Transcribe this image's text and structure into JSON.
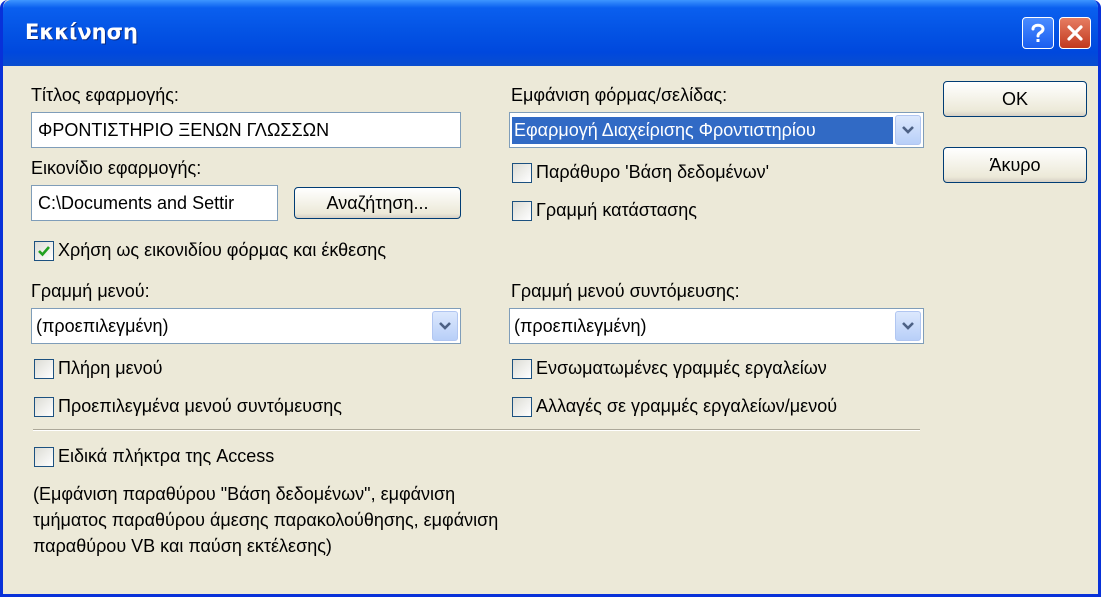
{
  "window": {
    "title": "Εκκίνηση"
  },
  "titlebar": {
    "help_icon": "question-mark-icon",
    "close_icon": "close-x-icon"
  },
  "form": {
    "app_title_label": "Τίτλος εφαρμογής:",
    "app_title_value": "ΦΡΟΝΤΙΣΤΗΡΙΟ ΞΕΝΩΝ ΓΛΩΣΣΩΝ",
    "app_icon_label": "Εικονίδιο εφαρμογής:",
    "app_icon_value": "C:\\Documents and Settir",
    "browse_label": "Αναζήτηση...",
    "use_as_icon_label": "Χρήση ως εικονιδίου φόρμας και έκθεσης",
    "use_as_icon_checked": true,
    "menu_bar_label": "Γραμμή μενού:",
    "menu_bar_value": "(προεπιλεγμένη)",
    "full_menus_label": "Πλήρη μενού",
    "default_shortcut_menus_label": "Προεπιλεγμένα μενού συντόμευσης",
    "display_form_label": "Εμφάνιση φόρμας/σελίδας:",
    "display_form_value": "Εφαρμογή Διαχείρισης Φροντιστηρίου",
    "database_window_label": "Παράθυρο 'Βάση δεδομένων'",
    "status_bar_label": "Γραμμή κατάστασης",
    "shortcut_menu_bar_label": "Γραμμή μενού συντόμευσης:",
    "shortcut_menu_bar_value": "(προεπιλεγμένη)",
    "builtin_toolbars_label": "Ενσωματωμένες γραμμές εργαλείων",
    "toolbar_changes_label": "Αλλαγές σε γραμμές εργαλείων/μενού",
    "special_keys_label": "Ειδικά πλήκτρα της Access",
    "special_keys_note": "(Εμφάνιση παραθύρου \"Βάση δεδομένων\", εμφάνιση τμήματος παραθύρου άμεσης παρακολούθησης, εμφάνιση παραθύρου VB και παύση εκτέλεσης)"
  },
  "buttons": {
    "ok_label": "OK",
    "cancel_label": "Άκυρο"
  },
  "colors": {
    "titlebar": "#0454e5",
    "dialog_bg": "#ece9d8",
    "selection": "#316ac5",
    "checkmark": "#21a121"
  }
}
